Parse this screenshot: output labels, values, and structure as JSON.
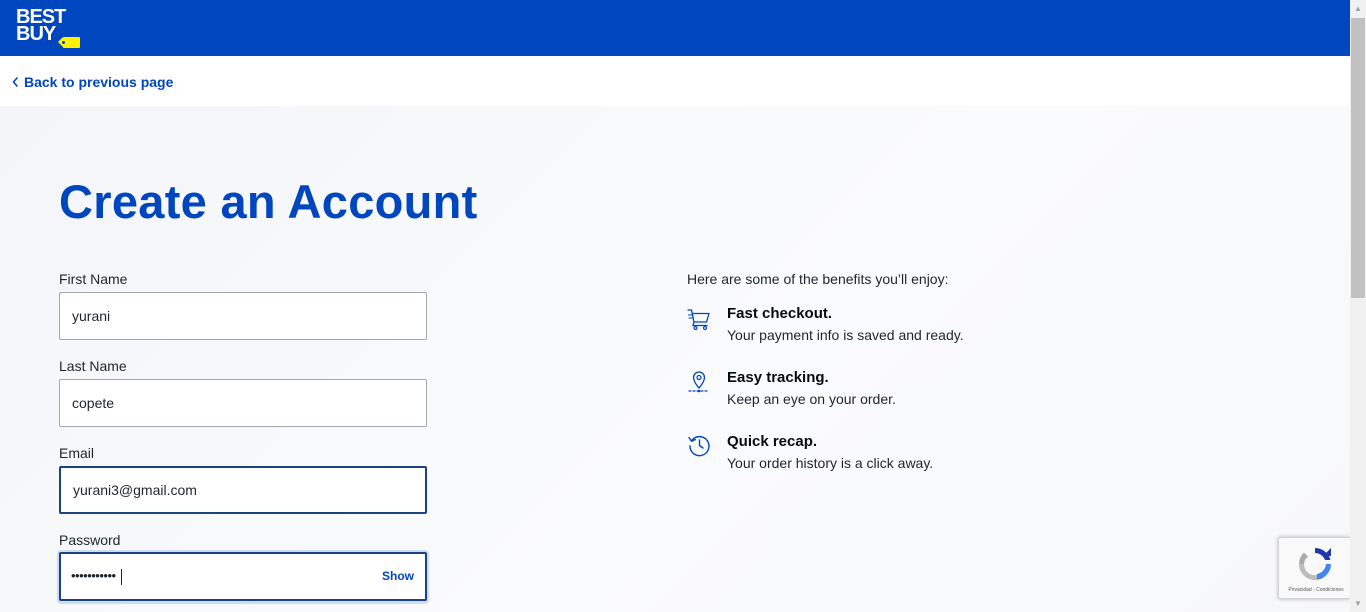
{
  "header": {
    "brand_line1": "BEST",
    "brand_line2": "BUY"
  },
  "nav": {
    "back_label": "Back to previous page"
  },
  "page": {
    "title": "Create an Account"
  },
  "form": {
    "first_name": {
      "label": "First Name",
      "value": "yurani"
    },
    "last_name": {
      "label": "Last Name",
      "value": "copete"
    },
    "email": {
      "label": "Email",
      "value": "yurani3@gmail.com"
    },
    "password": {
      "label": "Password",
      "masked_value": "•••••••••••",
      "show_label": "Show"
    }
  },
  "benefits": {
    "intro": "Here are some of the benefits you’ll enjoy:",
    "items": [
      {
        "icon": "cart-icon",
        "title": "Fast checkout.",
        "desc": "Your payment info is saved and ready."
      },
      {
        "icon": "location-pin-icon",
        "title": "Easy tracking.",
        "desc": "Keep an eye on your order."
      },
      {
        "icon": "history-clock-icon",
        "title": "Quick recap.",
        "desc": "Your order history is a click away."
      }
    ]
  },
  "recaptcha": {
    "links": "Privacidad - Condiciones"
  },
  "colors": {
    "brand_blue": "#0046be",
    "brand_yellow": "#fff200",
    "focus_border": "#1d4280"
  }
}
